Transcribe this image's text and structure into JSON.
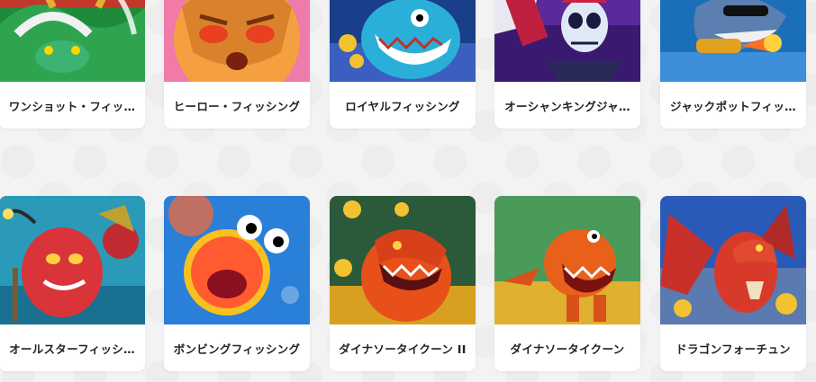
{
  "games": [
    {
      "title": "ワンショット・フィッ…",
      "art": "dragon-green-art"
    },
    {
      "title": "ヒーロー・フィッシング",
      "art": "hero-mask-art"
    },
    {
      "title": "ロイヤルフィッシング",
      "art": "blue-dragon-art"
    },
    {
      "title": "オーシャンキングジャ…",
      "art": "skeleton-king-art"
    },
    {
      "title": "ジャックポットフィッ…",
      "art": "shark-art"
    },
    {
      "title": "オールスターフィッシ…",
      "art": "red-monster-art"
    },
    {
      "title": "ボンビングフィッシング",
      "art": "pufferfish-art"
    },
    {
      "title": "ダイナソータイクーン II",
      "art": "dinosaur-orange-art"
    },
    {
      "title": "ダイナソータイクーン",
      "art": "trex-art"
    },
    {
      "title": "ドラゴンフォーチュン",
      "art": "red-dragon-art"
    }
  ]
}
